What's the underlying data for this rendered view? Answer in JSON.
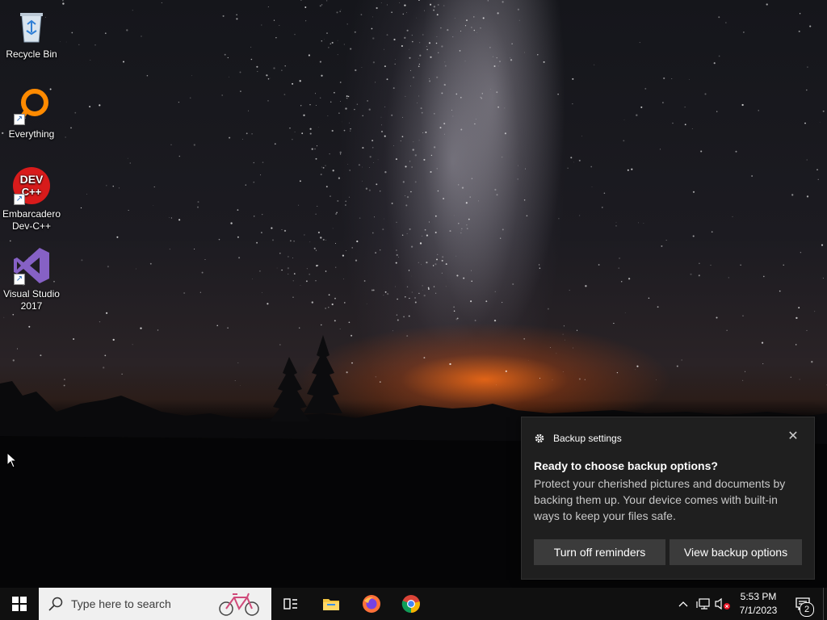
{
  "desktop": {
    "icons": [
      {
        "label": "Recycle Bin",
        "icon": "recycle-bin-icon"
      },
      {
        "label": "Everything",
        "icon": "everything-search-icon"
      },
      {
        "label": "Embarcadero Dev-C++",
        "icon": "dev-cpp-icon",
        "icon_text": "DEV\nC++"
      },
      {
        "label": "Visual Studio 2017",
        "icon": "visual-studio-icon"
      }
    ]
  },
  "toast": {
    "app_name": "Backup settings",
    "app_icon": "gear-icon",
    "close_glyph": "✕",
    "title": "Ready to choose backup options?",
    "body": "Protect your cherished pictures and documents by backing them up. Your device comes with built-in ways to keep your files safe.",
    "buttons": {
      "turn_off": "Turn off reminders",
      "view": "View backup options"
    }
  },
  "taskbar": {
    "search_placeholder": "Type here to search",
    "pinned": [
      "task-view-icon",
      "file-explorer-icon",
      "firefox-icon",
      "chrome-icon"
    ],
    "clock": {
      "time": "5:53 PM",
      "date": "7/1/2023"
    },
    "notification_count": "2"
  }
}
